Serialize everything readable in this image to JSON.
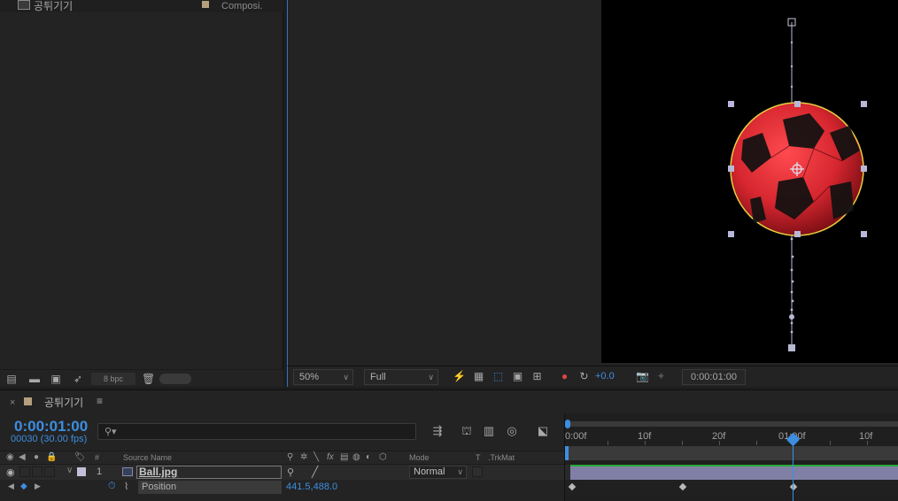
{
  "project": {
    "item_name": "공튀기기",
    "item_type": "Composi.",
    "bpc": "8 bpc"
  },
  "viewer": {
    "zoom": "50%",
    "resolution": "Full",
    "exposure": "+0.0",
    "timecode": "0:00:01:00"
  },
  "timeline": {
    "comp_name": "공튀기기",
    "menu": "≡",
    "timecode": "0:00:01:00",
    "frames": "00030 (30.00 fps)",
    "search_placeholder": "",
    "columns": {
      "number": "#",
      "source_name": "Source Name",
      "mode": "Mode",
      "t": "T",
      "trkmat": ".TrkMat"
    },
    "layer": {
      "number": "1",
      "name": "Ball.jpg",
      "mode": "Normal"
    },
    "property": {
      "name": "Position",
      "value": "441.5,488.0"
    },
    "ruler": [
      "0:00f",
      "10f",
      "20f",
      "01:00f",
      "10f"
    ]
  },
  "colors": {
    "accent": "#3d8ee0",
    "comp_label": "#b4a07c",
    "layer_bar": "#8080a6",
    "ball_red": "#d6262f",
    "path": "#b8b8d0"
  },
  "icons": {
    "project_bar": [
      "interpret-footage-icon",
      "new-folder-icon",
      "new-comp-icon",
      "flowchart-icon",
      "trash-icon"
    ],
    "viewer_bar": [
      "fast-preview-icon",
      "transparency-grid-icon",
      "mask-visibility-icon",
      "region-of-interest-icon",
      "guides-icon",
      "color-channels-icon",
      "reset-exposure-icon",
      "snapshot-icon",
      "show-snapshot-icon"
    ],
    "timeline_tools": [
      "comp-flowchart-icon",
      "draft-3d-icon",
      "frame-blending-icon",
      "motion-blur-icon",
      "graph-editor-icon"
    ]
  }
}
